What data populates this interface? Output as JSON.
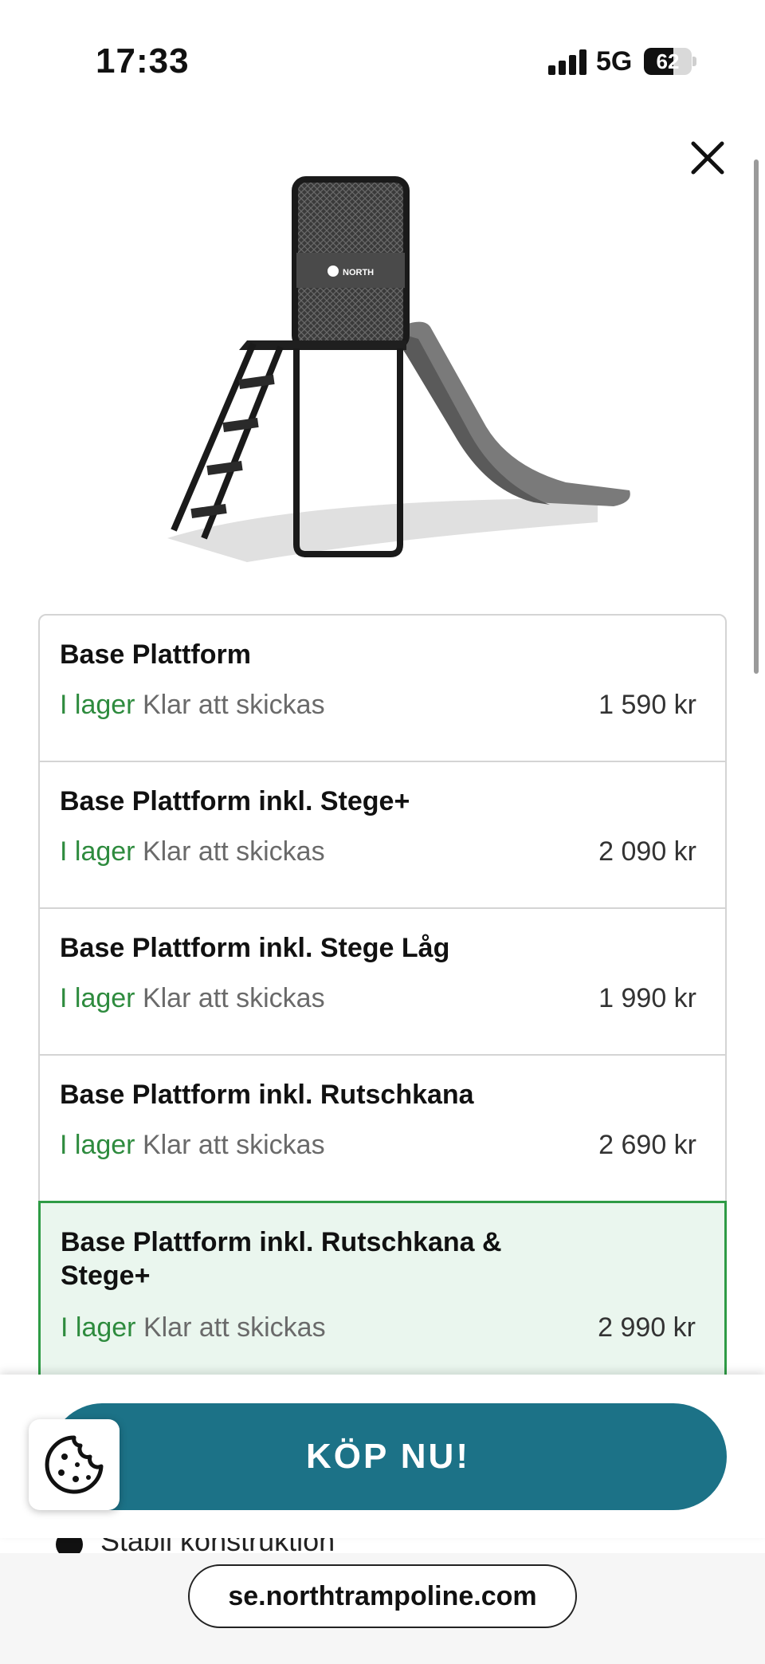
{
  "status_bar": {
    "time": "17:33",
    "network": "5G",
    "battery": "62"
  },
  "product": {
    "logo_text": "NORTH"
  },
  "variants": [
    {
      "name": "Base Plattform",
      "stock": "I lager",
      "ship": "Klar att skickas",
      "price": "1 590 kr",
      "selected": false
    },
    {
      "name": "Base Plattform inkl. Stege+",
      "stock": "I lager",
      "ship": "Klar att skickas",
      "price": "2 090 kr",
      "selected": false
    },
    {
      "name": "Base Plattform inkl. Stege Låg",
      "stock": "I lager",
      "ship": "Klar att skickas",
      "price": "1 990 kr",
      "selected": false
    },
    {
      "name": "Base Plattform inkl. Rutschkana",
      "stock": "I lager",
      "ship": "Klar att skickas",
      "price": "2 690 kr",
      "selected": false
    },
    {
      "name": "Base Plattform inkl. Rutschkana & Stege+",
      "stock": "I lager",
      "ship": "Klar att skickas",
      "price": "2 990 kr",
      "selected": true
    }
  ],
  "buy": {
    "label": "KÖP NU!"
  },
  "feature_peek": "Stabil konstruktion",
  "browser": {
    "url": "se.northtrampoline.com"
  },
  "colors": {
    "accent": "#1c7287",
    "in_stock": "#2e8b3e",
    "selected_border": "#2e9b45",
    "selected_bg": "#eaf6ee"
  }
}
